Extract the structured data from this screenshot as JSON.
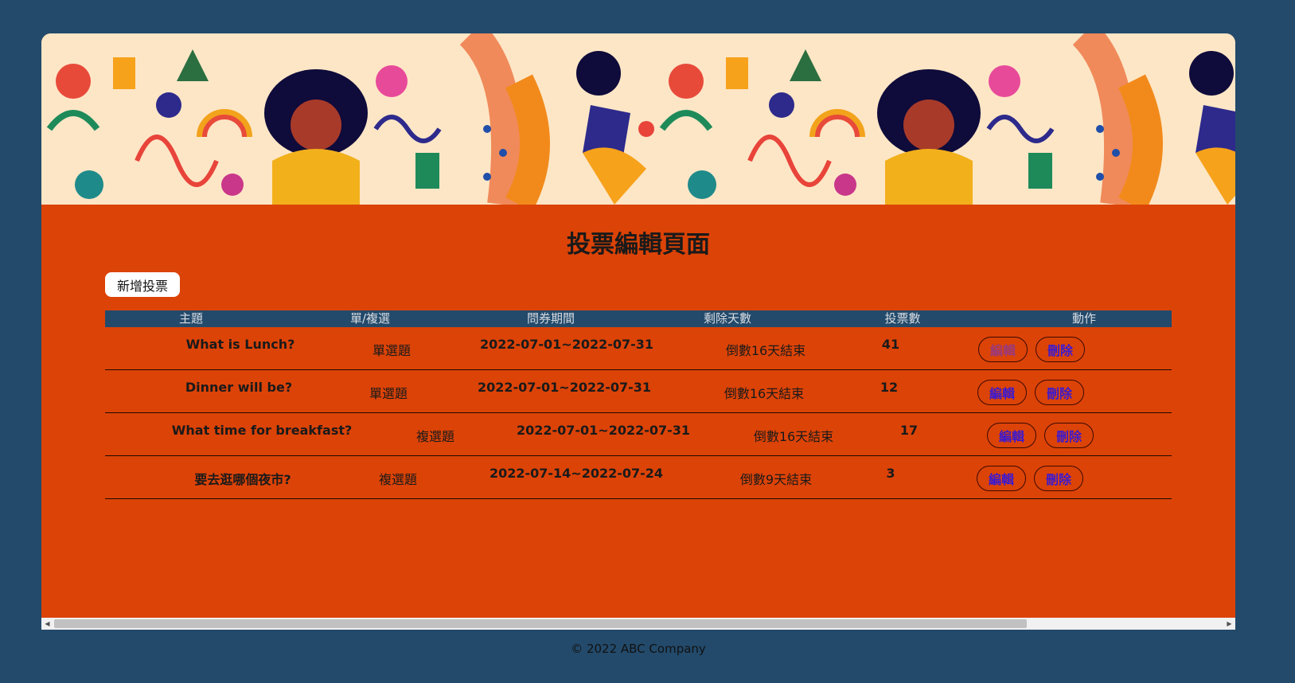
{
  "page": {
    "title": "投票編輯頁面",
    "add_button_label": "新增投票"
  },
  "table": {
    "headers": [
      "主題",
      "單/複選",
      "問券期間",
      "剩除天數",
      "投票數",
      "動作"
    ],
    "rows": [
      {
        "subject": "What is Lunch?",
        "type": "單選題",
        "period": "2022-07-01~2022-07-31",
        "remaining": "倒數16天結束",
        "votes": "41",
        "edit_label": "編輯",
        "delete_label": "刪除"
      },
      {
        "subject": "Dinner will be?",
        "type": "單選題",
        "period": "2022-07-01~2022-07-31",
        "remaining": "倒數16天結束",
        "votes": "12",
        "edit_label": "編輯",
        "delete_label": "刪除"
      },
      {
        "subject": "What time for breakfast?",
        "type": "複選題",
        "period": "2022-07-01~2022-07-31",
        "remaining": "倒數16天結束",
        "votes": "17",
        "edit_label": "編輯",
        "delete_label": "刪除"
      },
      {
        "subject": "要去逛哪個夜市?",
        "type": "複選題",
        "period": "2022-07-14~2022-07-24",
        "remaining": "倒數9天結束",
        "votes": "3",
        "edit_label": "編輯",
        "delete_label": "刪除"
      }
    ]
  },
  "footer": {
    "text": "© 2022 ABC Company"
  },
  "colors": {
    "background": "#234a6b",
    "card": "#dc4307",
    "header_row": "#234a6b",
    "action_text": "#3b1ad1"
  }
}
